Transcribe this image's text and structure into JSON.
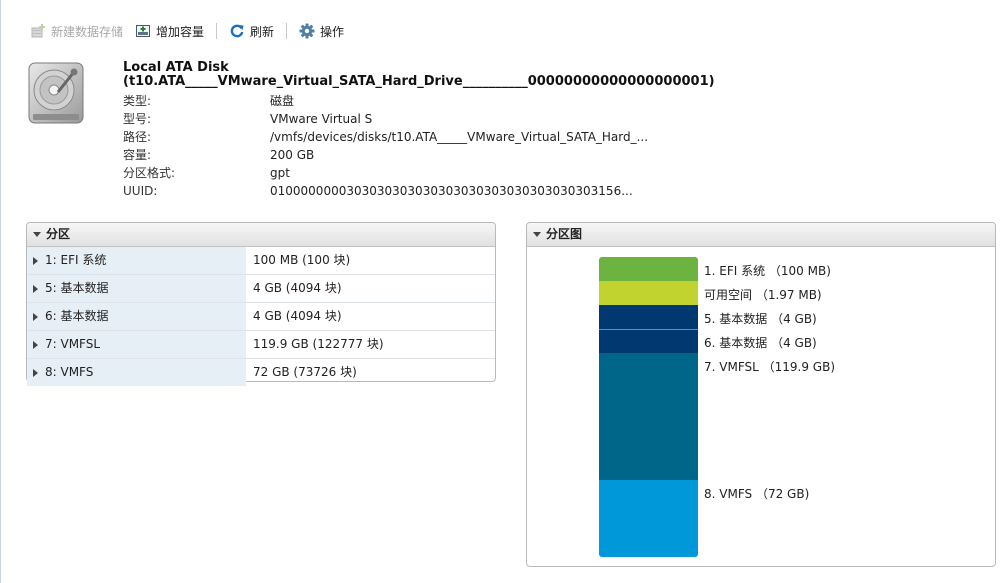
{
  "toolbar": {
    "new_datastore": "新建数据存储",
    "increase_capacity": "增加容量",
    "refresh": "刷新",
    "actions": "操作"
  },
  "disk": {
    "title_line1": "Local ATA Disk",
    "title_line2": "(t10.ATA_____VMware_Virtual_SATA_Hard_Drive__________00000000000000000001)",
    "properties": [
      {
        "label": "类型:",
        "value": "磁盘"
      },
      {
        "label": "型号:",
        "value": "VMware Virtual S"
      },
      {
        "label": "路径:",
        "value": "/vmfs/devices/disks/t10.ATA_____VMware_Virtual_SATA_Hard_..."
      },
      {
        "label": "容量:",
        "value": "200 GB"
      },
      {
        "label": "分区格式:",
        "value": "gpt"
      },
      {
        "label": "UUID:",
        "value": "0100000000303030303030303030303030303030303156..."
      }
    ]
  },
  "partitions_panel": {
    "title": "分区",
    "rows": [
      {
        "name": "1: EFI 系统",
        "size": "100 MB (100 块)"
      },
      {
        "name": "5: 基本数据",
        "size": "4 GB (4094 块)"
      },
      {
        "name": "6: 基本数据",
        "size": "4 GB (4094 块)"
      },
      {
        "name": "7: VMFSL",
        "size": "119.9 GB (122777 块)"
      },
      {
        "name": "8: VMFS",
        "size": "72 GB (73726 块)"
      }
    ]
  },
  "map_panel": {
    "title": "分区图",
    "segments": [
      {
        "label": "1. EFI 系统 （100 MB)",
        "gb": 0.1,
        "color": "#6db33f"
      },
      {
        "label": "可用空间 （1.97 MB)",
        "gb": 0.002,
        "color": "#c1d32f"
      },
      {
        "label": "5. 基本数据 （4 GB)",
        "gb": 4,
        "color": "#00386f"
      },
      {
        "label": "6. 基本数据 （4 GB)",
        "gb": 4,
        "color": "#00386f"
      },
      {
        "label": "7. VMFSL （119.9 GB)",
        "gb": 119.9,
        "color": "#006689"
      },
      {
        "label": "8. VMFS （72 GB)",
        "gb": 72,
        "color": "#0098d8"
      }
    ]
  }
}
